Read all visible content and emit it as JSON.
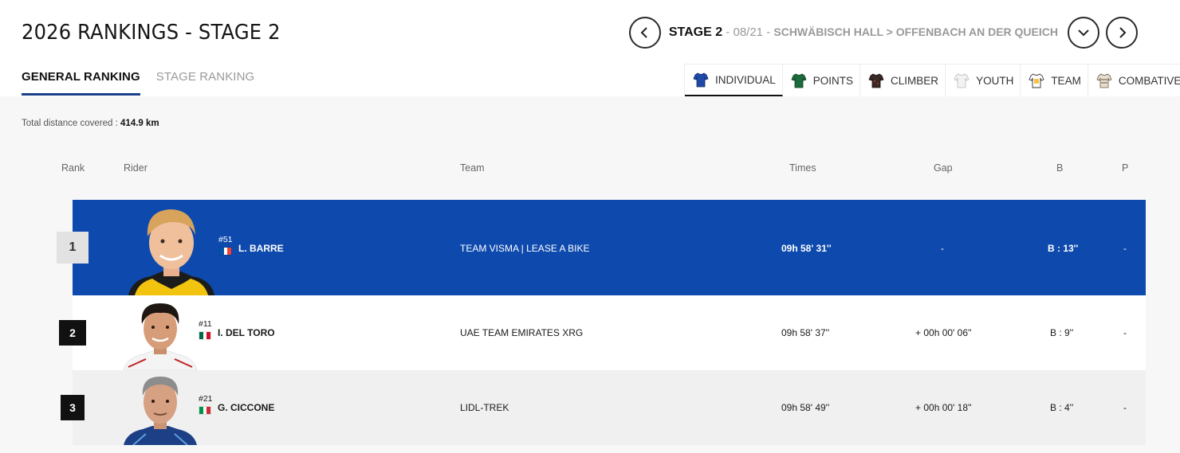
{
  "header": {
    "title": "2026 RANKINGS - STAGE 2",
    "ranking_tabs": [
      {
        "label": "GENERAL RANKING",
        "active": true
      },
      {
        "label": "STAGE RANKING",
        "active": false
      }
    ],
    "stage": {
      "label": "STAGE 2",
      "separator": " - ",
      "date": "08/21",
      "route_sep": " - ",
      "route": "SCHWÄBISCH HALL > OFFENBACH AN DER QUEICH"
    },
    "classification_tabs": [
      {
        "label": "INDIVIDUAL",
        "icon": "blue-jersey-icon",
        "color": "#1f4aa8",
        "active": true
      },
      {
        "label": "POINTS",
        "icon": "green-jersey-icon",
        "color": "#1c6b3a",
        "active": false
      },
      {
        "label": "CLIMBER",
        "icon": "climber-jersey-icon",
        "color": "#3a2a25",
        "active": false
      },
      {
        "label": "YOUTH",
        "icon": "white-jersey-icon",
        "color": "#f2f2f2",
        "active": false
      },
      {
        "label": "TEAM",
        "icon": "team-jersey-icon",
        "color": "#f5c542",
        "active": false
      },
      {
        "label": "COMBATIVE",
        "icon": "combative-jersey-icon",
        "color": "#d8d0c0",
        "active": false
      }
    ]
  },
  "summary": {
    "distance_label": "Total distance covered :",
    "distance_value": "414.9 km"
  },
  "columns": {
    "rank": "Rank",
    "rider": "Rider",
    "team": "Team",
    "times": "Times",
    "gap": "Gap",
    "bonus": "B",
    "penalty": "P"
  },
  "rows": [
    {
      "rank": "1",
      "bib": "#51",
      "name": "L. BARRE",
      "country": "France",
      "flag": [
        "#0055a4",
        "#ffffff",
        "#ef4135"
      ],
      "team": "TEAM VISMA | LEASE A BIKE",
      "time": "09h 58' 31''",
      "gap": "-",
      "bonus": "B : 13''",
      "penalty": "-"
    },
    {
      "rank": "2",
      "bib": "#11",
      "name": "I. DEL TORO",
      "country": "Mexico",
      "flag": [
        "#006847",
        "#ffffff",
        "#ce1126"
      ],
      "team": "UAE TEAM EMIRATES XRG",
      "time": "09h 58' 37''",
      "gap": "+ 00h 00' 06''",
      "bonus": "B : 9''",
      "penalty": "-"
    },
    {
      "rank": "3",
      "bib": "#21",
      "name": "G. CICCONE",
      "country": "Italy",
      "flag": [
        "#009246",
        "#ffffff",
        "#ce2b37"
      ],
      "team": "LIDL-TREK",
      "time": "09h 58' 49''",
      "gap": "+ 00h 00' 18''",
      "bonus": "B : 4''",
      "penalty": "-"
    }
  ],
  "colors": {
    "leader_row": "#0e4aad",
    "accent": "#1a3e8a"
  }
}
